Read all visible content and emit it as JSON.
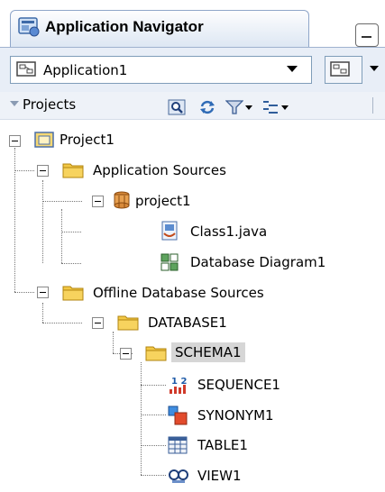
{
  "navigator": {
    "title": "Application Navigator",
    "application": "Application1",
    "section": "Projects"
  },
  "tree": {
    "project": "Project1",
    "app_sources": "Application Sources",
    "pkg": "project1",
    "class_file": "Class1.java",
    "db_diagram": "Database Diagram1",
    "offline_sources": "Offline Database Sources",
    "database": "DATABASE1",
    "schema": "SCHEMA1",
    "sequence": "SEQUENCE1",
    "synonym": "SYNONYM1",
    "table": "TABLE1",
    "view": "VIEW1"
  },
  "icons": [
    "app-navigator-icon",
    "application-icon",
    "search-icon",
    "refresh-icon",
    "filter-icon",
    "options-icon",
    "project-icon",
    "folder-icon",
    "package-icon",
    "java-class-icon",
    "db-diagram-icon",
    "sequence-icon",
    "synonym-icon",
    "table-icon",
    "view-icon"
  ]
}
